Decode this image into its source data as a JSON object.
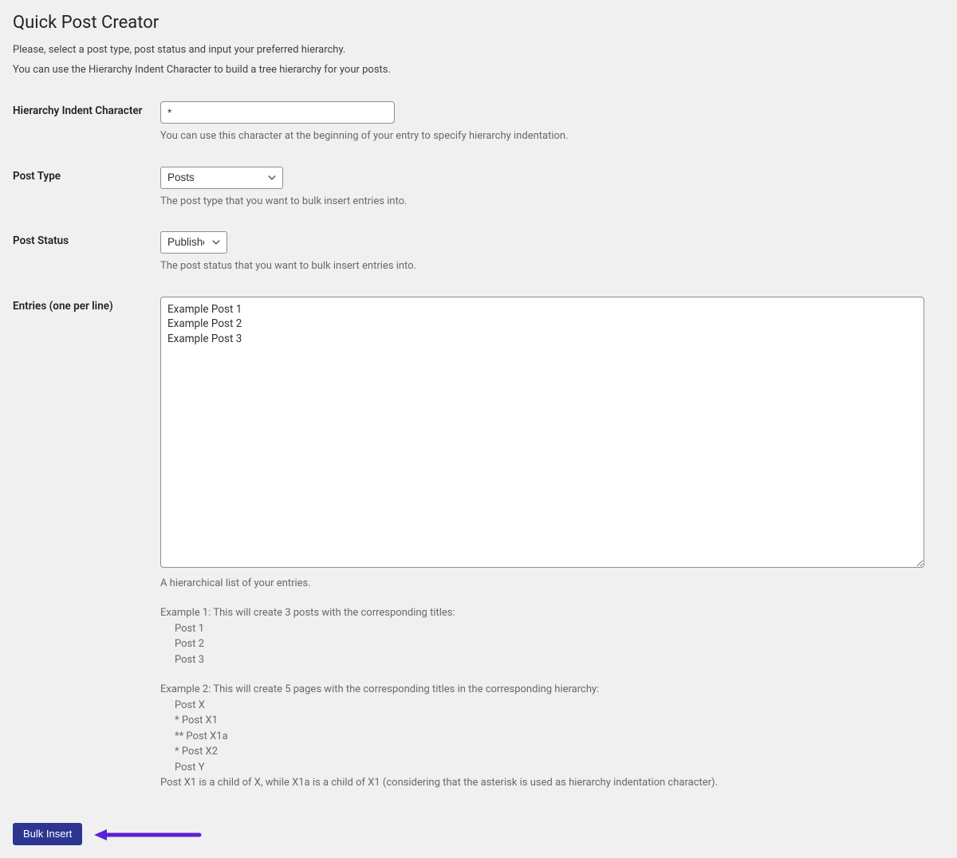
{
  "page": {
    "title": "Quick Post Creator",
    "intro1": "Please, select a post type, post status and input your preferred hierarchy.",
    "intro2": "You can use the Hierarchy Indent Character to build a tree hierarchy for your posts."
  },
  "fields": {
    "hierarchy": {
      "label": "Hierarchy Indent Character",
      "value": "*",
      "description": "You can use this character at the beginning of your entry to specify hierarchy indentation."
    },
    "post_type": {
      "label": "Post Type",
      "value": "Posts",
      "description": "The post type that you want to bulk insert entries into."
    },
    "post_status": {
      "label": "Post Status",
      "value": "Published",
      "description": "The post status that you want to bulk insert entries into."
    },
    "entries": {
      "label": "Entries (one per line)",
      "value": "Example Post 1\nExample Post 2\nExample Post 3",
      "description": "A hierarchical list of your entries.",
      "example1_heading": "Example 1: This will create 3 posts with the corresponding titles:",
      "example1_lines": [
        "Post 1",
        "Post 2",
        "Post 3"
      ],
      "example2_heading": "Example 2: This will create 5 pages with the corresponding titles in the corresponding hierarchy:",
      "example2_lines": [
        "Post X",
        "* Post X1",
        "** Post X1a",
        "* Post X2",
        "Post Y"
      ],
      "example2_footer": "Post X1 is a child of X, while X1a is a child of X1 (considering that the asterisk is used as hierarchy indentation character)."
    }
  },
  "submit": {
    "label": "Bulk Insert"
  }
}
